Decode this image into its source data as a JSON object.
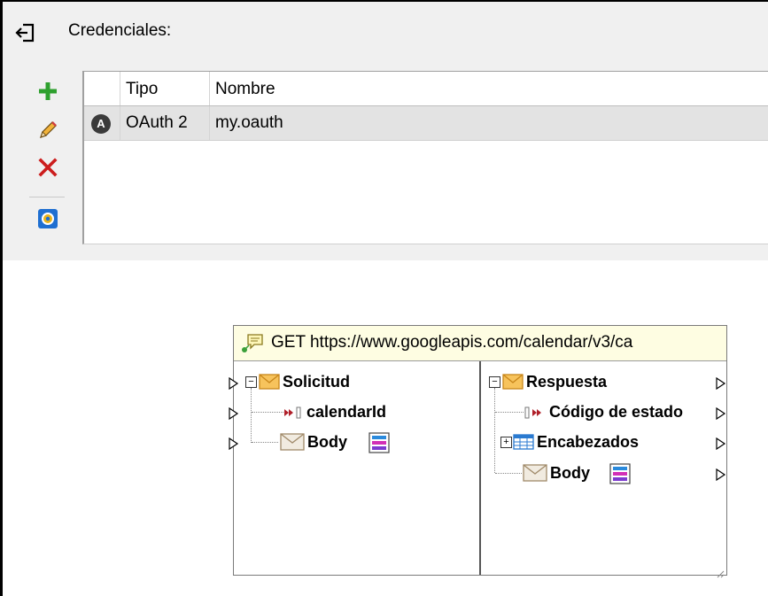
{
  "credentials": {
    "label": "Credenciales:",
    "columns": [
      "Tipo",
      "Nombre"
    ],
    "rows": [
      {
        "badge": "A",
        "type": "OAuth 2",
        "name": "my.oauth"
      }
    ],
    "toolbar": {
      "add_icon": "plus-icon",
      "edit_icon": "pencil-icon",
      "delete_icon": "x-icon",
      "settings_icon": "blue-gear-icon"
    }
  },
  "component": {
    "title": "GET https://www.googleapis.com/calendar/v3/ca",
    "request": {
      "root": "Solicitud",
      "param": "calendarId",
      "body": "Body"
    },
    "response": {
      "root": "Respuesta",
      "status": "Código de estado",
      "headers": "Encabezados",
      "body": "Body"
    },
    "colors": {
      "title_bg": "#fefde2",
      "envelope": "#f2a640",
      "param_arrow": "#b0202a"
    }
  }
}
